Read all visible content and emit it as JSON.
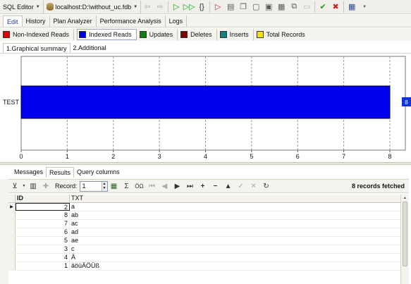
{
  "toolbar": {
    "editor_label": "SQL Editor",
    "connection_label": "localhost:D:\\without_uc.fdb",
    "buttons": [
      "commit-check",
      "rollback-x",
      "calc"
    ]
  },
  "tabs": [
    {
      "label": "Edit",
      "active": true
    },
    {
      "label": "History",
      "active": false
    },
    {
      "label": "Plan Analyzer",
      "active": false
    },
    {
      "label": "Performance Analysis",
      "active": false
    },
    {
      "label": "Logs",
      "active": false
    }
  ],
  "legend": [
    {
      "label": "Non-Indexed Reads",
      "color": "#e00000",
      "selected": false
    },
    {
      "label": "Indexed Reads",
      "color": "#0000ee",
      "selected": true
    },
    {
      "label": "Updates",
      "color": "#108010",
      "selected": false
    },
    {
      "label": "Deletes",
      "color": "#800000",
      "selected": false
    },
    {
      "label": "Inserts",
      "color": "#108080",
      "selected": false
    },
    {
      "label": "Total Records",
      "color": "#f2e600",
      "selected": false
    }
  ],
  "subtabs": [
    {
      "label": "1.Graphical summary",
      "active": true
    },
    {
      "label": "2.Additional",
      "active": false
    }
  ],
  "chart_data": {
    "type": "bar",
    "orientation": "horizontal",
    "categories": [
      "TEST"
    ],
    "series": [
      {
        "name": "Indexed Reads",
        "values": [
          8
        ]
      }
    ],
    "value_label": "8",
    "xlim": [
      0,
      8
    ],
    "xticks": [
      "0",
      "1",
      "2",
      "3",
      "4",
      "5",
      "6",
      "7",
      "8"
    ],
    "color": "#0000ee",
    "grid": true
  },
  "lower_tabs": [
    {
      "label": "Messages",
      "active": false
    },
    {
      "label": "Results",
      "active": true
    },
    {
      "label": "Query columns",
      "active": false
    }
  ],
  "grid_toolbar": {
    "record_label": "Record:",
    "record_value": "1",
    "fetched_text": "8 records fetched"
  },
  "grid": {
    "columns": [
      "ID",
      "TXT"
    ],
    "rows": [
      {
        "id": "2",
        "txt": "a"
      },
      {
        "id": "8",
        "txt": "ab"
      },
      {
        "id": "7",
        "txt": "ac"
      },
      {
        "id": "6",
        "txt": "ad"
      },
      {
        "id": "5",
        "txt": "ae"
      },
      {
        "id": "3",
        "txt": "c"
      },
      {
        "id": "4",
        "txt": "Ä"
      },
      {
        "id": "1",
        "txt": "äöüÄÖÜß"
      }
    ]
  }
}
